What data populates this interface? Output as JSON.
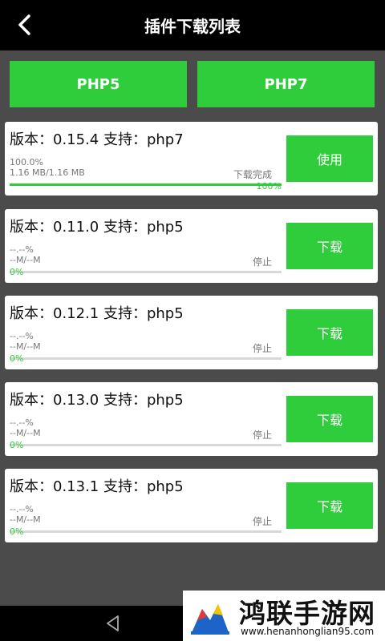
{
  "header": {
    "title": "插件下载列表",
    "back_icon": "back-arrow-icon"
  },
  "tabs": [
    {
      "label": "PHP5"
    },
    {
      "label": "PHP7"
    }
  ],
  "items": [
    {
      "title": "版本：0.15.4 支持：php7",
      "percent_text": "100.0%",
      "size_text": "1.16 MB/1.16 MB",
      "status": "下载完成",
      "progress_label": "100%",
      "progress": 1.0,
      "button": "使用"
    },
    {
      "title": "版本：0.11.0 支持：php5",
      "percent_text": "--.--%",
      "size_text": "--M/--M",
      "status": "停止",
      "progress_label": "0%",
      "progress": 0.0,
      "button": "下载"
    },
    {
      "title": "版本：0.12.1 支持：php5",
      "percent_text": "--.--%",
      "size_text": "--M/--M",
      "status": "停止",
      "progress_label": "0%",
      "progress": 0.0,
      "button": "下载"
    },
    {
      "title": "版本：0.13.0 支持：php5",
      "percent_text": "--.--%",
      "size_text": "--M/--M",
      "status": "停止",
      "progress_label": "0%",
      "progress": 0.0,
      "button": "下载"
    },
    {
      "title": "版本：0.13.1 支持：php5",
      "percent_text": "--.--%",
      "size_text": "--M/--M",
      "status": "停止",
      "progress_label": "0%",
      "progress": 0.0,
      "button": "下载"
    }
  ],
  "colors": {
    "accent": "#2fcc3b",
    "appbar": "#000000",
    "background": "#4b4b4b"
  },
  "watermark": {
    "name": "鸿联手游网",
    "url": "www.henanhonglian95.com"
  }
}
